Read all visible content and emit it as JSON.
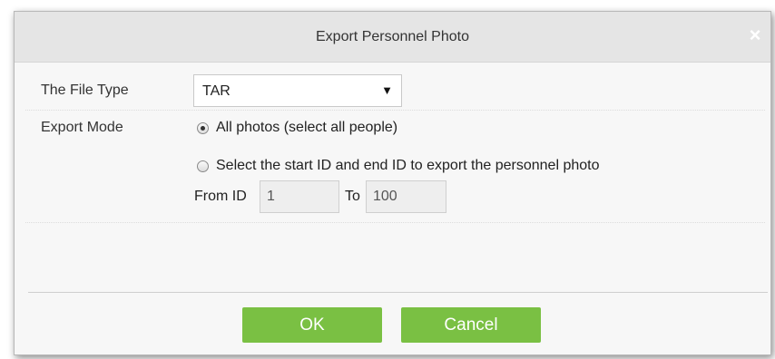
{
  "dialog": {
    "title": "Export Personnel Photo",
    "close_glyph": "×"
  },
  "file_type": {
    "label": "The File Type",
    "selected": "TAR",
    "arrow_glyph": "▼"
  },
  "export_mode": {
    "label": "Export Mode",
    "options": [
      {
        "label": "All photos (select all people)",
        "checked": true
      },
      {
        "label": "Select the start ID and end ID to export the personnel photo",
        "checked": false
      }
    ],
    "from_label": "From ID",
    "from_value": "1",
    "to_label": "To",
    "to_value": "100"
  },
  "buttons": {
    "ok": "OK",
    "cancel": "Cancel"
  },
  "colors": {
    "button_green": "#7ac043",
    "title_bar": "#e5e5e5",
    "dialog_bg": "#f7f7f7"
  },
  "icons": {
    "close": "close-icon",
    "dropdown": "chevron-down-icon"
  }
}
